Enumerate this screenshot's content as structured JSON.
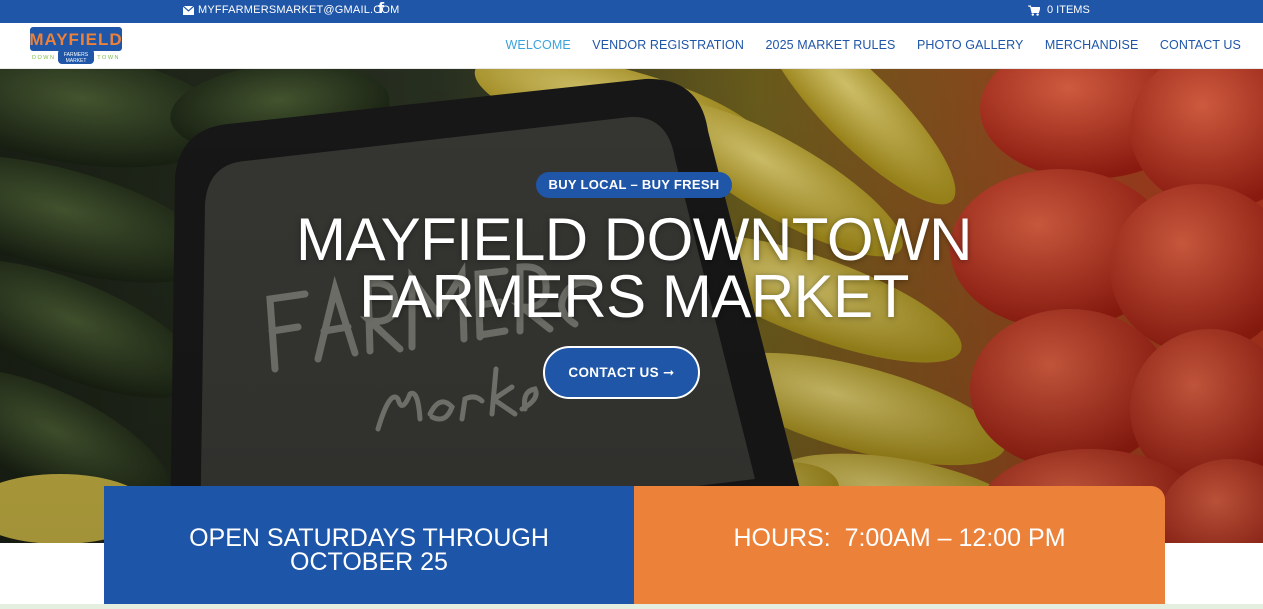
{
  "topbar": {
    "email": "MYFFARMERSMARKET@GMAIL.COM",
    "facebook_icon": "facebook-icon",
    "cart_label": "0 ITEMS"
  },
  "logo": {
    "main": "MAYFIELD",
    "left": "DOWN",
    "right": "TOWN",
    "badge_line1": "FARMERS",
    "badge_line2": "MARKET"
  },
  "nav": {
    "items": [
      {
        "label": "WELCOME",
        "active": true
      },
      {
        "label": "VENDOR REGISTRATION",
        "active": false
      },
      {
        "label": "2025 MARKET RULES",
        "active": false
      },
      {
        "label": "PHOTO GALLERY",
        "active": false
      },
      {
        "label": "MERCHANDISE",
        "active": false
      },
      {
        "label": "CONTACT US",
        "active": false
      }
    ]
  },
  "hero": {
    "tagline": "BUY LOCAL – BUY FRESH",
    "title_line1": "MAYFIELD DOWNTOWN",
    "title_line2": "FARMERS MARKET",
    "cta_label": "CONTACT US ➞"
  },
  "info": {
    "left_line1": "OPEN SATURDAYS THROUGH",
    "left_line2": "OCTOBER 25",
    "right_text": "HOURS:  7:00AM – 12:00 PM"
  },
  "colors": {
    "brand_blue": "#1f56a8",
    "active_nav": "#3aa3dd",
    "orange": "#ec813a"
  }
}
